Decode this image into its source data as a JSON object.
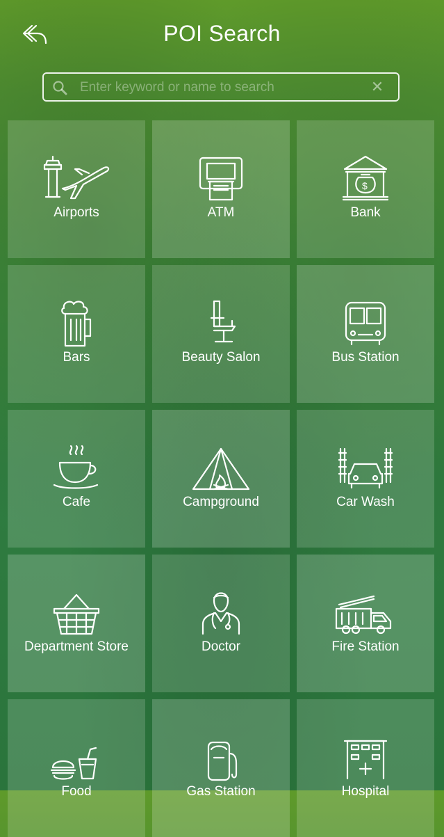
{
  "header": {
    "title": "POI Search"
  },
  "search": {
    "placeholder": "Enter keyword or name to search"
  },
  "tiles": [
    {
      "label": "Airports",
      "icon": "airport-icon"
    },
    {
      "label": "ATM",
      "icon": "atm-icon"
    },
    {
      "label": "Bank",
      "icon": "bank-icon"
    },
    {
      "label": "Bars",
      "icon": "beer-mug-icon"
    },
    {
      "label": "Beauty Salon",
      "icon": "salon-chair-icon"
    },
    {
      "label": "Bus Station",
      "icon": "bus-icon"
    },
    {
      "label": "Cafe",
      "icon": "coffee-cup-icon"
    },
    {
      "label": "Campground",
      "icon": "tent-icon"
    },
    {
      "label": "Car Wash",
      "icon": "car-wash-icon"
    },
    {
      "label": "Department Store",
      "icon": "basket-icon"
    },
    {
      "label": "Doctor",
      "icon": "doctor-icon"
    },
    {
      "label": "Fire Station",
      "icon": "fire-truck-icon"
    },
    {
      "label": "Food",
      "icon": "fast-food-icon"
    },
    {
      "label": "Gas Station",
      "icon": "gas-pump-icon"
    },
    {
      "label": "Hospital",
      "icon": "hospital-icon"
    }
  ]
}
